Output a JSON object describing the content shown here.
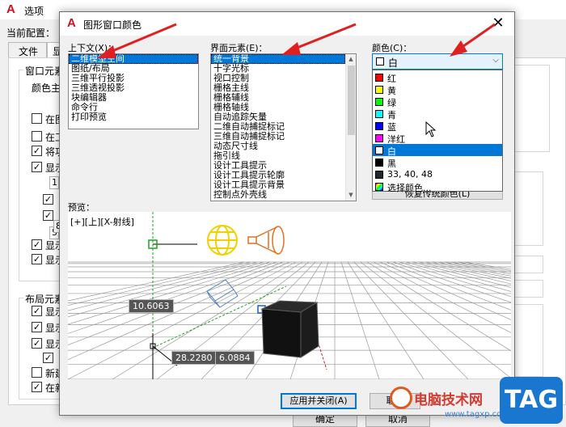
{
  "background_window": {
    "logo": "A",
    "title": "选项",
    "profile_label": "当前配置：",
    "tabs": [
      "文件",
      "显"
    ],
    "groups": {
      "window_elements": "窗口元素",
      "color_theme": "颜色主",
      "layout_elements": "布局元素"
    },
    "checkbox_labels": [
      "在图",
      "在工",
      "将功",
      "显示",
      "显示",
      "显示",
      "显示",
      "显示",
      "显示",
      "新建",
      "在新"
    ],
    "small_values": [
      "1",
      "5",
      "8"
    ],
    "ok_label": "确定",
    "cancel_label": "取消"
  },
  "dialog": {
    "logo": "A",
    "title": "图形窗口颜色",
    "close_symbol": "✕",
    "context_label": "上下文(X)：",
    "context_items": [
      "二维模型空间",
      "图纸/布局",
      "三维平行投影",
      "三维透视投影",
      "块编辑器",
      "命令行",
      "打印预览"
    ],
    "context_selected": 0,
    "element_label": "界面元素(E)：",
    "element_items": [
      "统一背景",
      "十字光标",
      "视口控制",
      "栅格主线",
      "栅格辅线",
      "栅格轴线",
      "自动追踪矢量",
      "二维自动捕捉标记",
      "三维自动捕捉标记",
      "动态尺寸线",
      "拖引线",
      "设计工具提示",
      "设计工具提示轮廓",
      "设计工具提示背景",
      "控制点外壳线"
    ],
    "element_selected": 0,
    "color_label": "颜色(C)：",
    "color_value": "白",
    "color_value_swatch": "#ffffff",
    "color_options": [
      {
        "label": "红",
        "swatch": "#ff0000"
      },
      {
        "label": "黄",
        "swatch": "#ffff00"
      },
      {
        "label": "绿",
        "swatch": "#00ff00"
      },
      {
        "label": "青",
        "swatch": "#00ffff"
      },
      {
        "label": "蓝",
        "swatch": "#0000ff"
      },
      {
        "label": "洋红",
        "swatch": "#ff00ff"
      },
      {
        "label": "白",
        "swatch": "#ffffff"
      },
      {
        "label": "黑",
        "swatch": "#000000"
      },
      {
        "label": "33, 40, 48",
        "swatch": "#212830"
      },
      {
        "label": "选择颜色...",
        "swatch": "multicolor"
      }
    ],
    "color_selected": 6,
    "restore_button": "恢复传统颜色(L)",
    "preview_label": "预览：",
    "preview_header": "[+][上][X-射线]",
    "coords": {
      "a": "10.6063",
      "b": "28.2280",
      "c": "6.0884"
    },
    "apply_button": "应用并关闭(A)",
    "cancel_button": "取消"
  },
  "watermark": {
    "site_name": "电脑技术网",
    "url": "www.tagxp.com",
    "tag": "TAG"
  },
  "colors": {
    "selection": "#0078d7",
    "annotation_arrow": "#e02020",
    "app_logo": "#d01020"
  }
}
